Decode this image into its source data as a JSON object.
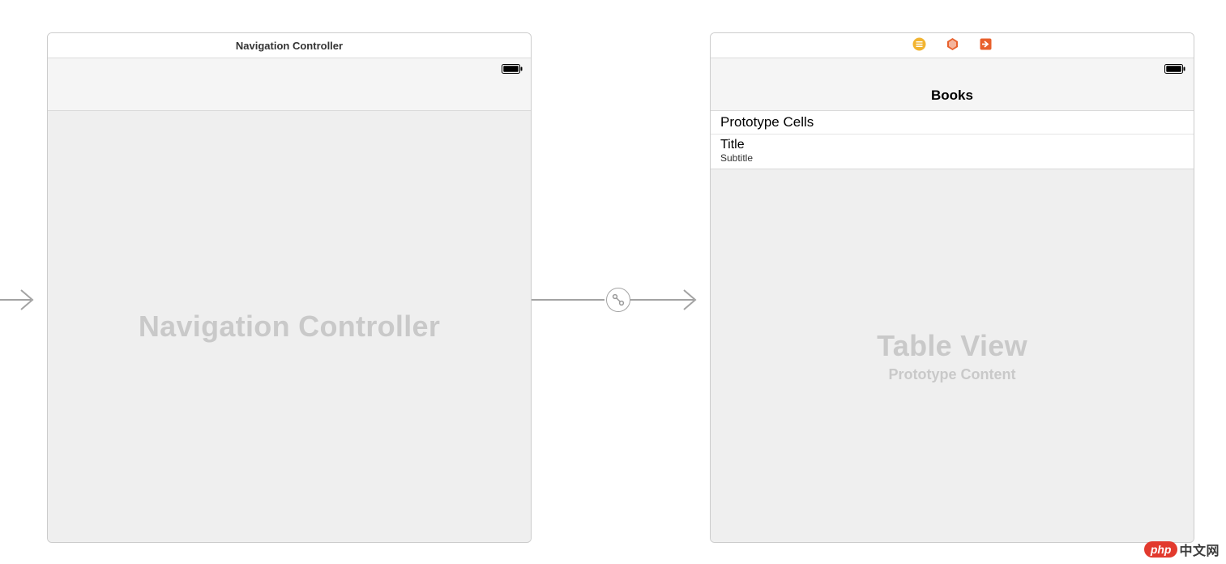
{
  "left_scene": {
    "title": "Navigation Controller",
    "placeholder": "Navigation Controller"
  },
  "right_scene": {
    "nav_title": "Books",
    "prototype_header": "Prototype Cells",
    "cell_title": "Title",
    "cell_subtitle": "Subtitle",
    "placeholder_primary": "Table View",
    "placeholder_secondary": "Prototype Content"
  },
  "icons": {
    "vc_icon": "view-controller-icon",
    "fr_icon": "first-responder-icon",
    "exit_icon": "exit-icon",
    "battery": "battery-icon",
    "segue": "segue-icon"
  },
  "watermark": {
    "pill": "php",
    "cn": "中文网"
  }
}
